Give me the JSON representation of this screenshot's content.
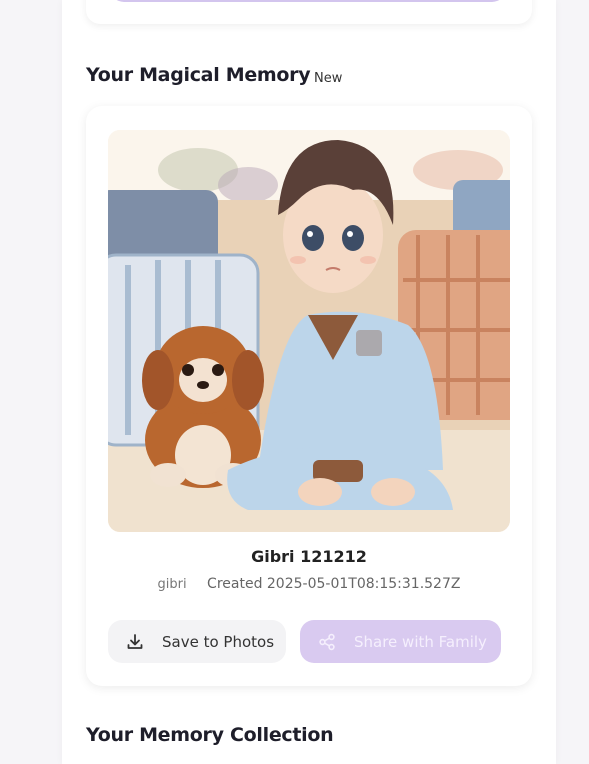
{
  "sections": {
    "memory_title": "Your Magical Memory",
    "memory_badge": "New",
    "collection_title": "Your Memory Collection"
  },
  "memory": {
    "title": "Gibri 121212",
    "owner": "gibri",
    "created": "Created 2025-05-01T08:15:31.527Z",
    "image_icon": "illustration-boy-with-puppy"
  },
  "actions": {
    "save_label": "Save to Photos",
    "save_icon": "download-icon",
    "share_label": "Share with Family",
    "share_icon": "share-icon"
  },
  "colors": {
    "accent": "#d9caf0",
    "accent_text": "#f5effd",
    "secondary_button": "#f3f3f5"
  }
}
